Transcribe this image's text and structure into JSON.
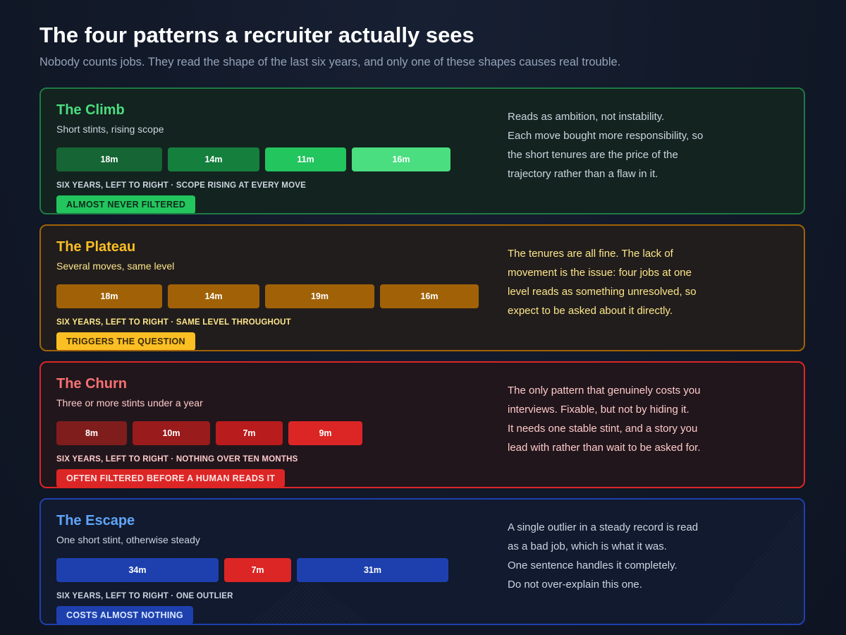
{
  "header": {
    "title": "The four patterns a recruiter actually sees",
    "subtitle": "Nobody counts jobs. They read the shape of the last six years, and only one of these shapes causes real trouble."
  },
  "patterns": [
    {
      "id": "climb",
      "title": "The Climb",
      "subtitle": "Short stints, rising scope",
      "stints": [
        {
          "label": "18m",
          "months": 18,
          "color": "#166534"
        },
        {
          "label": "14m",
          "months": 14,
          "color": "#15803d"
        },
        {
          "label": "11m",
          "months": 11,
          "color": "#22c55e"
        },
        {
          "label": "16m",
          "months": 16,
          "color": "#4ade80"
        }
      ],
      "caption": "SIX YEARS, LEFT TO RIGHT · SCOPE RISING AT EVERY MOVE",
      "badge": "ALMOST NEVER FILTERED",
      "description": [
        "Reads as ambition, not instability.",
        "Each move bought more responsibility, so",
        "the short tenures are the price of the",
        "trajectory rather than a flaw in it."
      ]
    },
    {
      "id": "plateau",
      "title": "The Plateau",
      "subtitle": "Several moves, same level",
      "stints": [
        {
          "label": "18m",
          "months": 18,
          "color": "#a16207"
        },
        {
          "label": "14m",
          "months": 14,
          "color": "#a16207"
        },
        {
          "label": "19m",
          "months": 19,
          "color": "#a16207"
        },
        {
          "label": "16m",
          "months": 16,
          "color": "#a16207"
        }
      ],
      "caption": "SIX YEARS, LEFT TO RIGHT · SAME LEVEL THROUGHOUT",
      "badge": "TRIGGERS THE QUESTION",
      "description": [
        "The tenures are all fine. The lack of",
        "movement is the issue: four jobs at one",
        "level reads as something unresolved, so",
        "expect to be asked about it directly."
      ]
    },
    {
      "id": "churn",
      "title": "The Churn",
      "subtitle": "Three or more stints under a year",
      "stints": [
        {
          "label": "8m",
          "months": 8,
          "color": "#7f1d1d"
        },
        {
          "label": "10m",
          "months": 10,
          "color": "#991b1b"
        },
        {
          "label": "7m",
          "months": 7,
          "color": "#b91c1c"
        },
        {
          "label": "9m",
          "months": 9,
          "color": "#dc2626"
        }
      ],
      "caption": "SIX YEARS, LEFT TO RIGHT · NOTHING OVER TEN MONTHS",
      "badge": "OFTEN FILTERED BEFORE A HUMAN READS IT",
      "description": [
        "The only pattern that genuinely costs you",
        "interviews. Fixable, but not by hiding it.",
        "It needs one stable stint, and a story you",
        "lead with rather than wait to be asked for."
      ]
    },
    {
      "id": "escape",
      "title": "The Escape",
      "subtitle": "One short stint, otherwise steady",
      "stints": [
        {
          "label": "34m",
          "months": 34,
          "color": "#1e40af"
        },
        {
          "label": "7m",
          "months": 7,
          "color": "#dc2626"
        },
        {
          "label": "31m",
          "months": 31,
          "color": "#1e40af"
        }
      ],
      "caption": "SIX YEARS, LEFT TO RIGHT · ONE OUTLIER",
      "badge": "COSTS ALMOST NOTHING",
      "description": [
        "A single outlier in a steady record is read",
        "as a bad job, which is what it was.",
        "One sentence handles it completely.",
        "Do not over-explain this one."
      ]
    }
  ]
}
